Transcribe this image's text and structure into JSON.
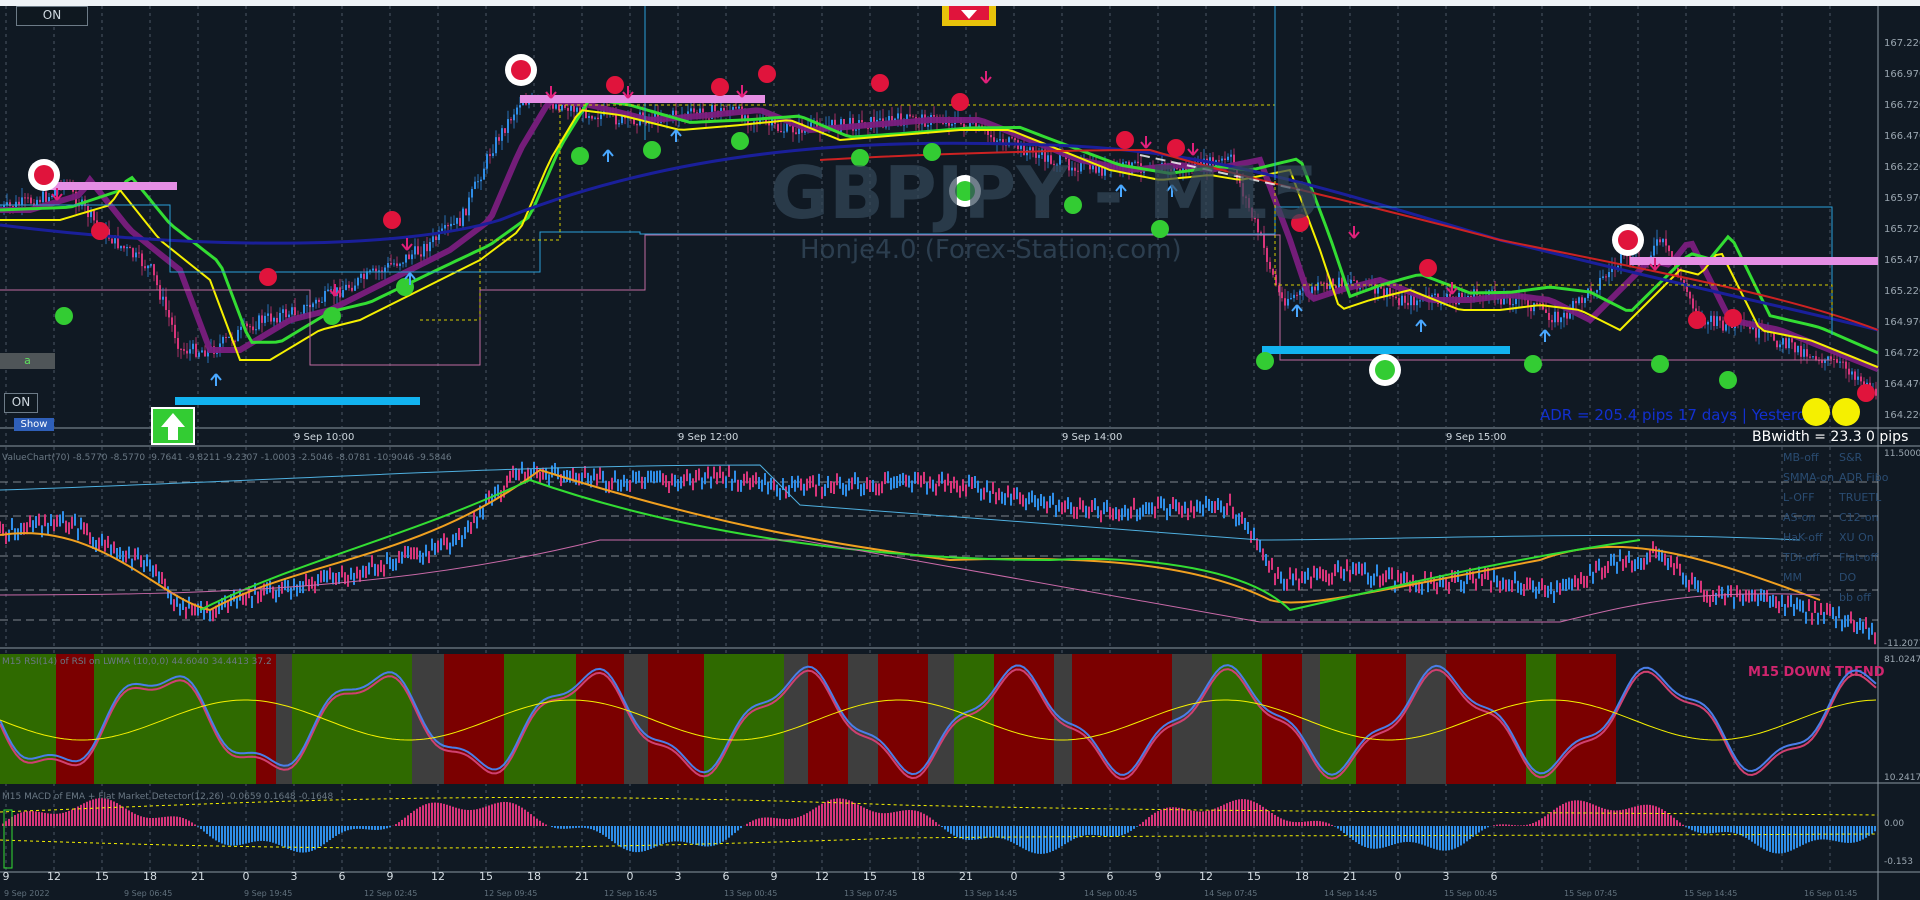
{
  "chart_data": {
    "type": "line",
    "symbol": "GBPJPY",
    "timeframe": "M15",
    "watermark": "GBPJPY - M15",
    "credit": "Honje4.0 (Forex-Station.com)",
    "price_axis": [
      "167.220",
      "166.970",
      "166.720",
      "166.470",
      "166.220",
      "165.970",
      "165.720",
      "165.470",
      "165.220",
      "164.970",
      "164.720",
      "164.470",
      "164.220"
    ],
    "date_labels": [
      "9 Sep 10:00",
      "9 Sep 12:00",
      "9 Sep 14:00",
      "9 Sep 15:00"
    ],
    "adr_text": "ADR = 205.4 pips  17 days  |  Yesterday",
    "bbwidth_text": "BBwidth = 23.3  0 pips",
    "value_chart": {
      "title": "ValueChart(70) -8.5770 -8.5770 -9.7641 -9.8211 -9.2307 -1.0003 -2.5046 -8.0781 -10.9046 -9.5846",
      "axis_top": "11.5000",
      "axis_bottom": "-11.2077"
    },
    "rsi_panel": {
      "title": "M15 RSI(14) of RSI on LWMA (10,0,0) 44.6040 34.4413 37.2",
      "trend_label": "M15 DOWN TREND",
      "axis_top": "81.0247",
      "axis_bottom": "10.2417"
    },
    "macd_panel": {
      "title": "M15 MACD of EMA + Flat Market Detector(12,26) -0.0659 0.1648 -0.1648",
      "axis": [
        "0.00",
        "-0.153"
      ]
    },
    "time_axis": [
      "9",
      "12",
      "15",
      "18",
      "21",
      "0",
      "3",
      "6",
      "9",
      "12",
      "15",
      "18",
      "21",
      "0",
      "3",
      "6",
      "9",
      "12",
      "15",
      "18",
      "21",
      "0",
      "3",
      "6",
      "9",
      "12",
      "15",
      "18",
      "21",
      "0",
      "3",
      "6"
    ],
    "bottom_axis": [
      "9 Sep 2022",
      "9 Sep 06:45",
      "9 Sep 19:45",
      "12 Sep 02:45",
      "12 Sep 09:45",
      "12 Sep 16:45",
      "13 Sep 00:45",
      "13 Sep 07:45",
      "13 Sep 14:45",
      "14 Sep 00:45",
      "14 Sep 07:45",
      "14 Sep 14:45",
      "15 Sep 00:45",
      "15 Sep 07:45",
      "15 Sep 14:45",
      "16 Sep 01:45"
    ]
  },
  "side_buttons": {
    "top": [
      "MB-off",
      "S&R",
      "SMMA-on",
      "ADR Fibo",
      "L-OFF",
      "TRUETL",
      "AS-on",
      "C12-on",
      "HaK-off",
      "XU On",
      "TDi-off",
      "Flat-off",
      "MM",
      "DO",
      "",
      "bb off"
    ]
  },
  "controls": {
    "on_top": "ON",
    "on_mid": "ON",
    "show": "Show",
    "a": "a"
  },
  "colors": {
    "background": "#101923",
    "grid": "#3a4754",
    "up_candle": "#2f8ee8",
    "down_candle": "#d8357a",
    "green": "#33dd33",
    "yellow": "#f5f000",
    "purple": "#7a1d7e",
    "navy": "#1a1f9a",
    "red": "#cc2222",
    "pink_bar": "#e58ee4",
    "blue_bar": "#12b3f0",
    "rsi_green": "#2f6a00",
    "rsi_red": "#7b0000",
    "rsi_gray": "#3e3e3e",
    "trend_text": "#d0256e"
  }
}
